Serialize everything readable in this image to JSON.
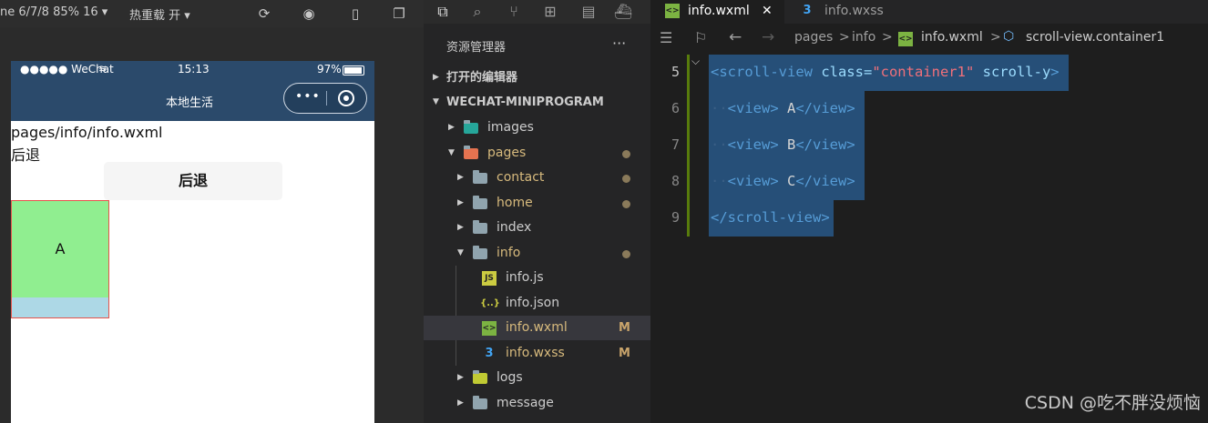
{
  "simulator": {
    "toolbar": {
      "device_info": "ne 6/7/8 85% 16 ▾",
      "hot_reload": "热重载 开 ▾"
    },
    "status_bar": {
      "signal": "●●●●● WeChat",
      "time": "15:13",
      "battery": "97%"
    },
    "nav_title": "本地生活",
    "capsule_dots": "•••",
    "page_path": "pages/info/info.wxml",
    "back_text": "后退",
    "back_button_label": "后退",
    "view_a_label": "A"
  },
  "explorer": {
    "title": "资源管理器",
    "more": "···",
    "open_editors": "打开的编辑器",
    "project": "WECHAT-MINIPROGRAM",
    "tree": [
      {
        "label": "images"
      },
      {
        "label": "pages"
      },
      {
        "label": "contact"
      },
      {
        "label": "home"
      },
      {
        "label": "index"
      },
      {
        "label": "info"
      },
      {
        "label": "info.js"
      },
      {
        "label": "info.json",
        "icon": "{..}"
      },
      {
        "label": "info.wxml",
        "badge": "M"
      },
      {
        "label": "info.wxss",
        "badge": "M"
      },
      {
        "label": "logs"
      },
      {
        "label": "message"
      }
    ]
  },
  "editor": {
    "tabs": [
      {
        "label": "info.wxml",
        "close": "✕"
      },
      {
        "label": "info.wxss"
      }
    ],
    "breadcrumb": {
      "p1": "pages",
      "sep": ">",
      "p2": "info",
      "p3": "info.wxml",
      "p4": "scroll-view.container1"
    },
    "lines": [
      {
        "num": "5",
        "open": "<scroll-view",
        "attr1": " class=",
        "val": "\"container1\"",
        "attr2": " scroll-y",
        "close": ">"
      },
      {
        "num": "6",
        "indent": "··",
        "open": "<view>",
        "text": " A",
        "close": "</view>"
      },
      {
        "num": "7",
        "indent": "··",
        "open": "<view>",
        "text": " B",
        "close": "</view>"
      },
      {
        "num": "8",
        "indent": "··",
        "open": "<view>",
        "text": " C",
        "close": "</view>"
      },
      {
        "num": "9",
        "open": "</scroll-view>"
      }
    ]
  },
  "watermark": "CSDN @吃不胖没烦恼",
  "colors": {
    "nav_bg": "#2b4a6b",
    "view_a": "#90ee90",
    "scroll_bg": "#add8e6",
    "selection": "#264f78"
  }
}
